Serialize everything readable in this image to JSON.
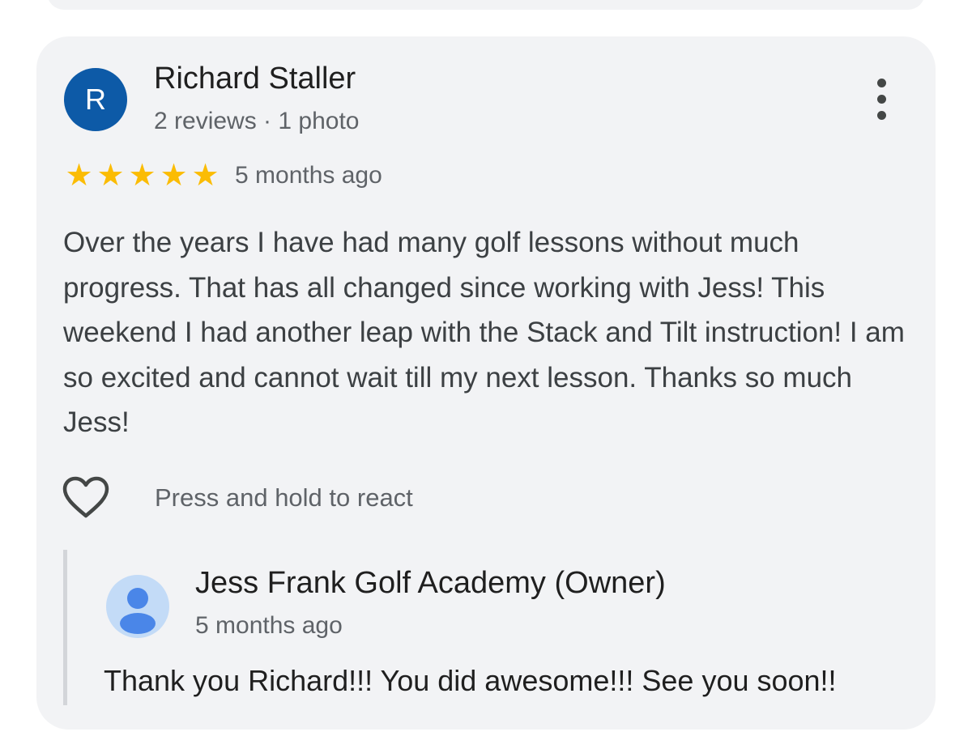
{
  "review": {
    "author_initial": "R",
    "author_name": "Richard Staller",
    "author_meta": "2 reviews · 1 photo",
    "rating": 5,
    "max_rating": 5,
    "time": "5 months ago",
    "text": "Over the years I have had many golf lessons without much progress. That has all changed since working with Jess! This weekend I had another leap with the Stack and Tilt instruction! I am so excited and cannot wait till my next lesson. Thanks so much Jess!",
    "react_label": "Press and hold to react"
  },
  "owner_reply": {
    "name": "Jess Frank Golf Academy (Owner)",
    "time": "5 months ago",
    "text": "Thank you Richard!!! You did awesome!!! See you soon!!"
  },
  "icons": {
    "more": "more-vert-icon",
    "heart": "heart-outline-icon",
    "star": "star-icon",
    "owner_avatar": "person-icon"
  },
  "colors": {
    "card_background": "#f2f3f5",
    "avatar": "#0d5aa7",
    "star": "#fbbc04",
    "owner_avatar_bg": "#c3dbf7",
    "owner_avatar_fg": "#4a86e8"
  }
}
